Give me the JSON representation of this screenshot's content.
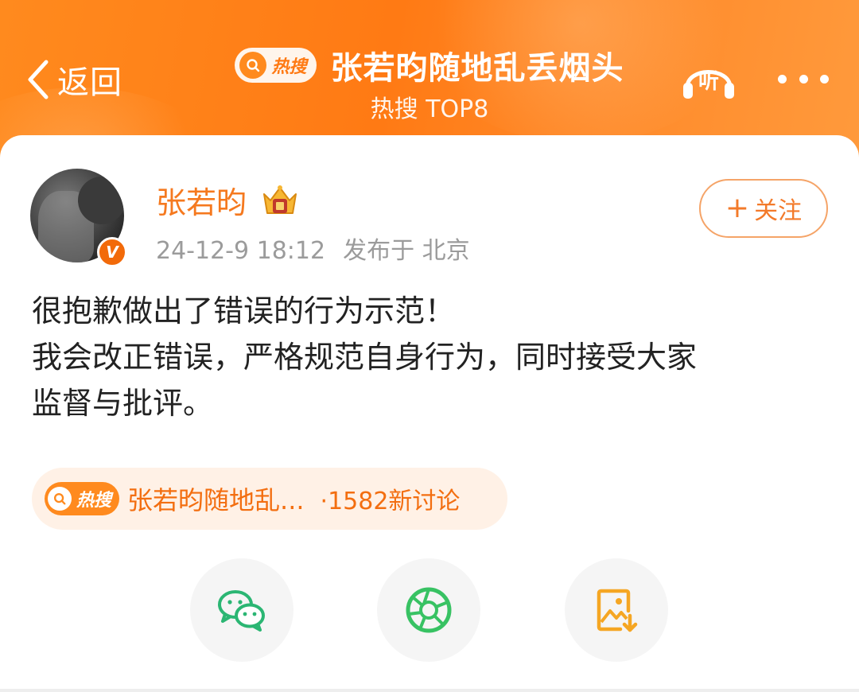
{
  "header": {
    "back_label": "返回",
    "hot_badge": "热搜",
    "title": "张若昀随地乱丢烟头",
    "subtitle": "热搜 TOP8",
    "listen_label": "听"
  },
  "post": {
    "username": "张若昀",
    "time": "24-12-9 18:12",
    "location": "发布于 北京",
    "follow_label": "关注",
    "lines": [
      "很抱歉做出了错误的行为示范！",
      "我会改正错误，严格规范自身行为，同时接受大家",
      "监督与批评。"
    ]
  },
  "topic": {
    "badge": "热搜",
    "text": "张若昀随地乱...",
    "count": "·1582新讨论"
  },
  "colors": {
    "header_orange": "#ff7a14",
    "username_orange": "#f5791f",
    "wechat_green": "#2bb673",
    "moments_green": "#38c263",
    "save_orange": "#f5a623"
  },
  "icons": [
    "chevron-left-icon",
    "search-icon",
    "headphones-icon",
    "more-icon",
    "verified-icon",
    "crown-icon",
    "wechat-icon",
    "moments-icon",
    "save-image-icon"
  ]
}
